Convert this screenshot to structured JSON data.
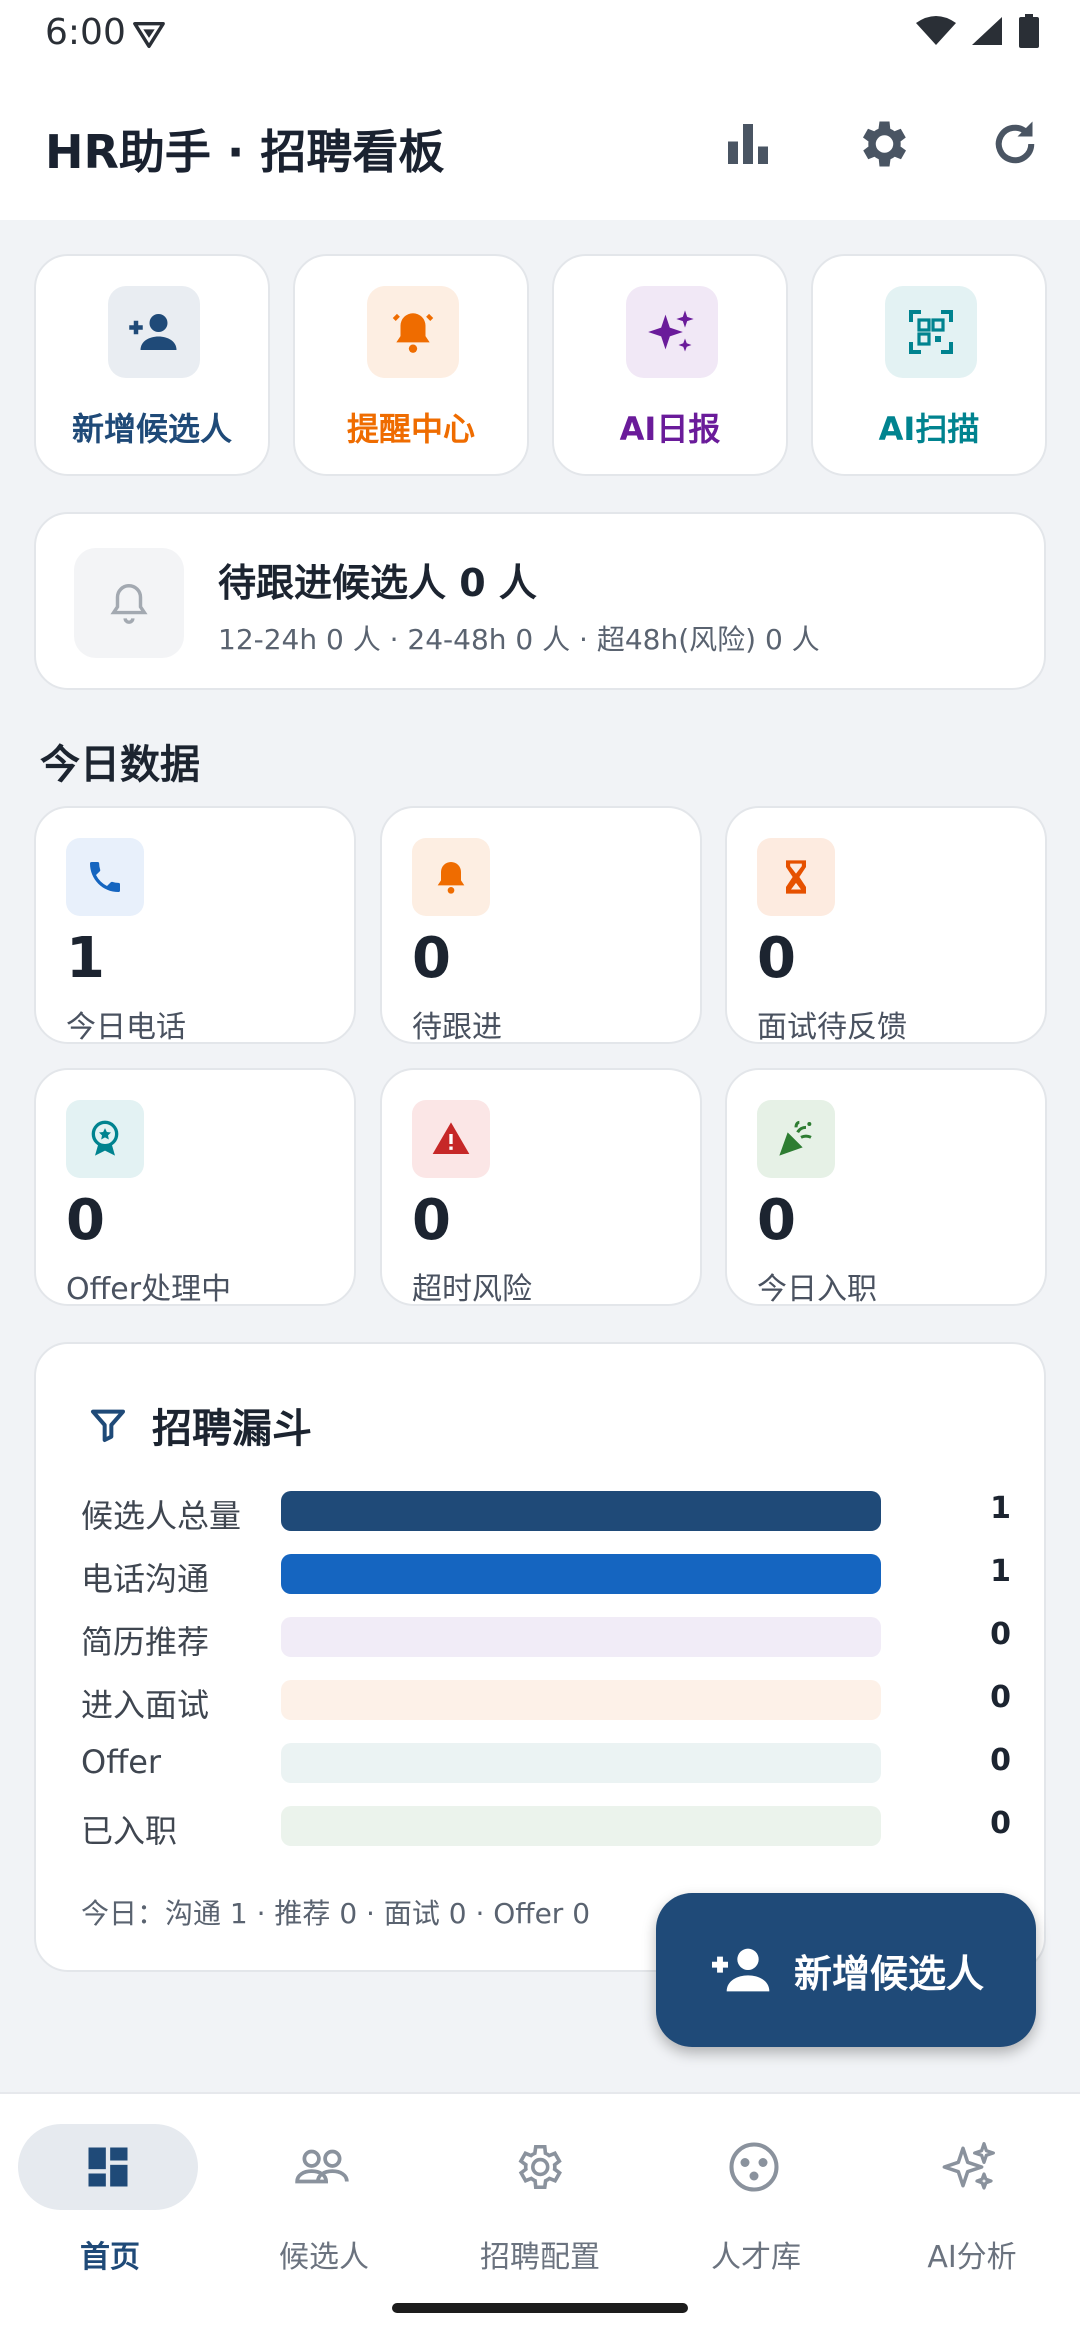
{
  "status_bar": {
    "time": "6:00"
  },
  "app_bar": {
    "title": "HR助手 · 招聘看板",
    "icons": [
      "bar-chart-icon",
      "gear-icon",
      "refresh-icon"
    ]
  },
  "quick_actions": [
    {
      "label": "新增候选人",
      "icon": "add-person-icon",
      "color": "#1f4a78",
      "bg": "#e9edf2"
    },
    {
      "label": "提醒中心",
      "icon": "alarm-bell-icon",
      "color": "#ef6c00",
      "bg": "#fdeee2"
    },
    {
      "label": "AI日报",
      "icon": "sparkle-icon",
      "color": "#6a1b9a",
      "bg": "#f1e8f6"
    },
    {
      "label": "AI扫描",
      "icon": "qr-scan-icon",
      "color": "#00838f",
      "bg": "#e3f2f3"
    }
  ],
  "pending": {
    "title": "待跟进候选人 0 人",
    "detail": "12-24h 0 人 · 24-48h 0 人 · 超48h(风险) 0 人"
  },
  "today_section": {
    "title": "今日数据"
  },
  "stats": [
    {
      "value": "1",
      "label": "今日电话",
      "icon": "phone-icon",
      "color": "#1565c0",
      "bg": "#e8f0fb"
    },
    {
      "value": "0",
      "label": "待跟进",
      "icon": "bell-icon",
      "color": "#ef6c00",
      "bg": "#fdeee2"
    },
    {
      "value": "0",
      "label": "面试待反馈",
      "icon": "hourglass-icon",
      "color": "#e65100",
      "bg": "#fdebe0"
    },
    {
      "value": "0",
      "label": "Offer处理中",
      "icon": "award-icon",
      "color": "#00838f",
      "bg": "#e3f2f3"
    },
    {
      "value": "0",
      "label": "超时风险",
      "icon": "warning-icon",
      "color": "#c62828",
      "bg": "#fbe6e6"
    },
    {
      "value": "0",
      "label": "今日入职",
      "icon": "celebration-icon",
      "color": "#2e7d32",
      "bg": "#e6f1e6"
    }
  ],
  "funnel": {
    "title": "招聘漏斗",
    "rows": [
      {
        "label": "候选人总量",
        "value": "1",
        "fraction": 1,
        "color": "#1f4a78",
        "track": "#e8edf3"
      },
      {
        "label": "电话沟通",
        "value": "1",
        "fraction": 1,
        "color": "#1565c0",
        "track": "#e6eefa"
      },
      {
        "label": "简历推荐",
        "value": "0",
        "fraction": 0,
        "color": "#6a1b9a",
        "track": "#f1ecf7"
      },
      {
        "label": "进入面试",
        "value": "0",
        "fraction": 0,
        "color": "#ef6c00",
        "track": "#fdf1e8"
      },
      {
        "label": "Offer",
        "value": "0",
        "fraction": 0,
        "color": "#00838f",
        "track": "#ebf3f3"
      },
      {
        "label": "已入职",
        "value": "0",
        "fraction": 0,
        "color": "#2e7d32",
        "track": "#ebf3ec"
      }
    ],
    "footer": "今日：沟通 1 · 推荐 0 · 面试 0 · Offer 0"
  },
  "fab": {
    "label": "新增候选人"
  },
  "bottom_nav": [
    {
      "label": "首页",
      "icon": "dashboard-icon",
      "active": true
    },
    {
      "label": "候选人",
      "icon": "people-icon",
      "active": false
    },
    {
      "label": "招聘配置",
      "icon": "gear-icon",
      "active": false
    },
    {
      "label": "人才库",
      "icon": "talent-pool-icon",
      "active": false
    },
    {
      "label": "AI分析",
      "icon": "sparkle-icon",
      "active": false
    }
  ]
}
